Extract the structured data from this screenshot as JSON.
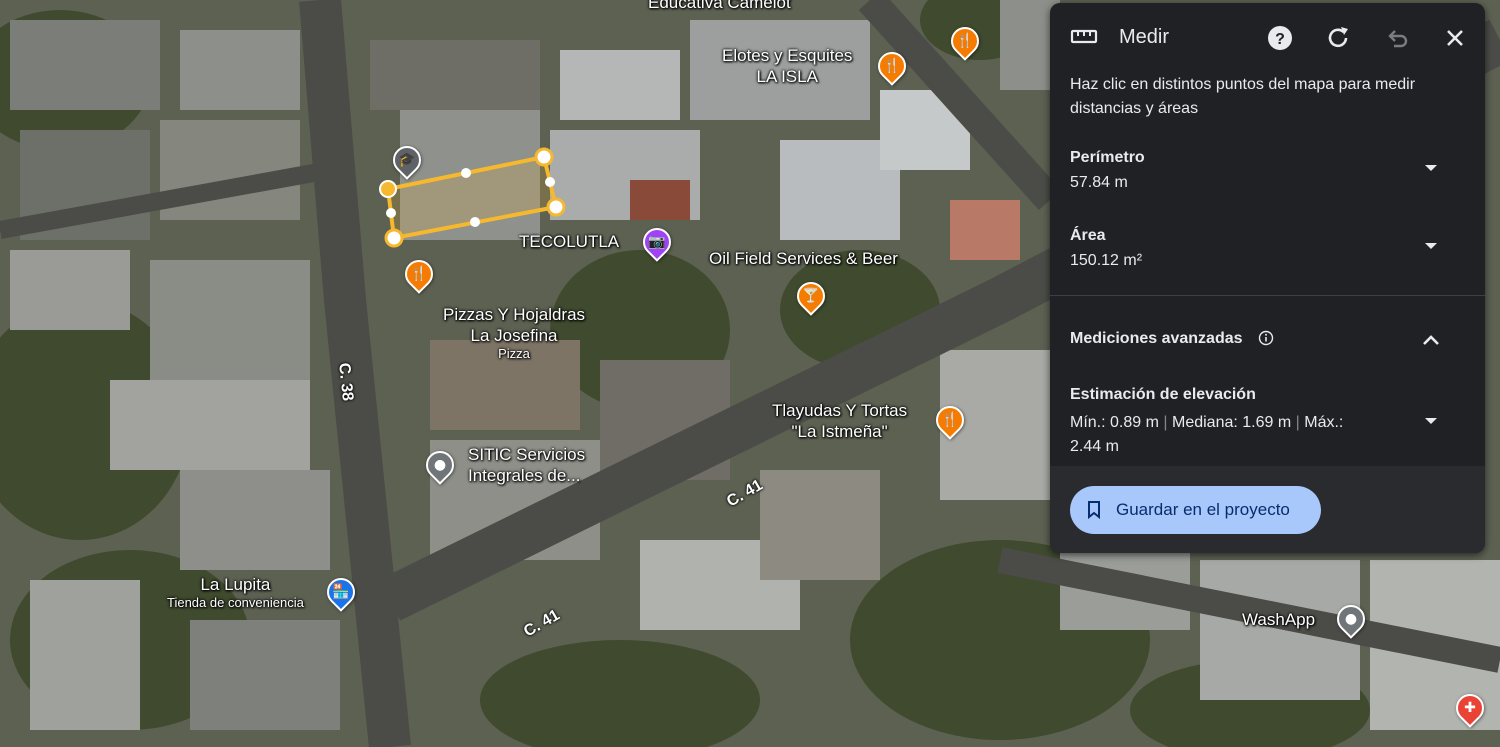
{
  "panel": {
    "title": "Medir",
    "description": "Haz clic en distintos puntos del mapa para medir distancias y áreas",
    "perimeter": {
      "label": "Perímetro",
      "value": "57.84 m"
    },
    "area": {
      "label": "Área",
      "value": "150.12 m²"
    },
    "advanced": {
      "label": "Mediciones avanzadas"
    },
    "elevation": {
      "label": "Estimación de elevación",
      "min": "Mín.: 0.89 m",
      "median": "Mediana: 1.69 m",
      "max_label": "Máx.:",
      "max_value": "2.44 m"
    },
    "save_button": "Guardar en el proyecto"
  },
  "map": {
    "places": {
      "camelot": "Educativa Camelot",
      "elotes_1": "Elotes y Esquites",
      "elotes_2": "LA ISLA",
      "tecolutla": "TECOLUTLA",
      "oil_field": "Oil Field Services & Beer",
      "pizzas_1": "Pizzas Y Hojaldras",
      "pizzas_2": "La Josefina",
      "pizzas_type": "Pizza",
      "tlayudas_1": "Tlayudas Y Tortas",
      "tlayudas_2": "\"La Istmeña\"",
      "sitic_1": "SITIC Servicios",
      "sitic_2": "Integrales de...",
      "lupita": "La Lupita",
      "lupita_type": "Tienda de conveniencia",
      "washapp": "WashApp"
    },
    "roads": {
      "c38": "C. 38",
      "c41_a": "C. 41",
      "c41_b": "C. 41"
    }
  },
  "colors": {
    "measure_line": "#f5b82e",
    "food_pin": "#f57c00",
    "school_pin": "#5f6368",
    "photo_pin": "#a142f4",
    "shop_pin": "#1a73e8",
    "generic_pin": "#70757a",
    "panel_bg": "#202124",
    "save_button_bg": "#a8c7fa"
  }
}
